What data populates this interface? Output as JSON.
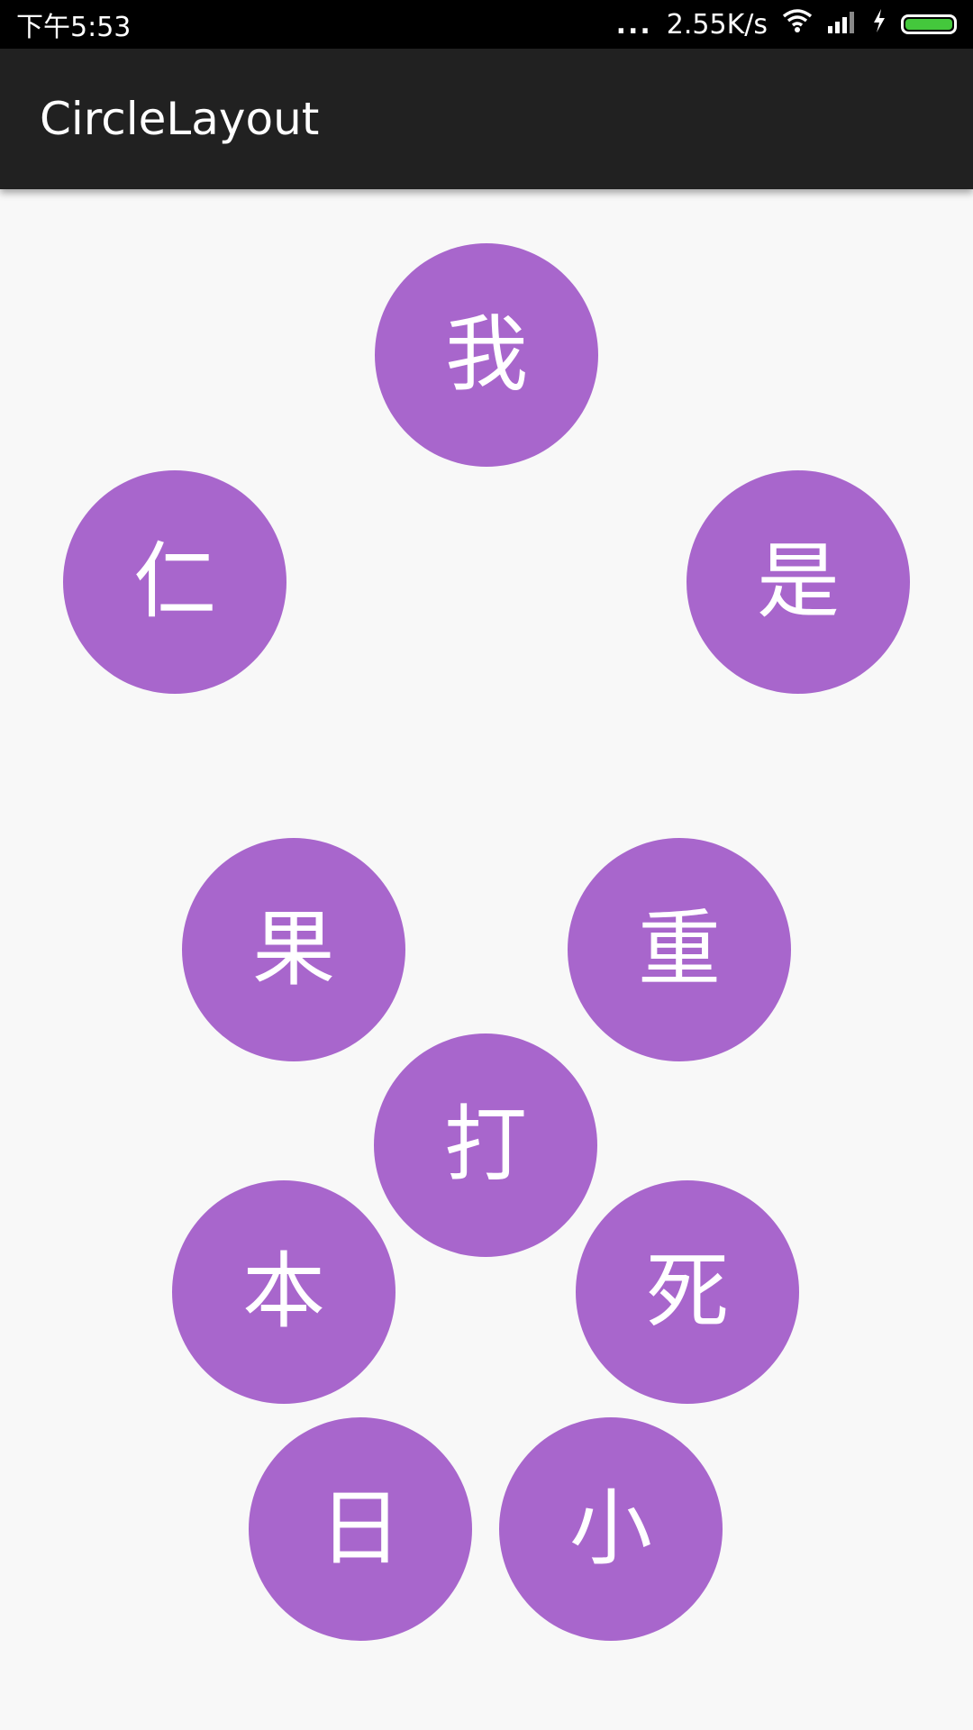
{
  "status_bar": {
    "time": "下午5:53",
    "more": "...",
    "network_speed": "2.55K/s",
    "icons": [
      "wifi-icon",
      "signal-icon",
      "charging-icon",
      "battery-icon"
    ],
    "battery_color": "#44c83c"
  },
  "app_bar": {
    "title": "CircleLayout",
    "background": "#212121"
  },
  "circles": {
    "accent": "#a866cc",
    "items": [
      "我",
      "是",
      "仁",
      "重",
      "果",
      "打",
      "本",
      "死",
      "日",
      "小"
    ]
  }
}
